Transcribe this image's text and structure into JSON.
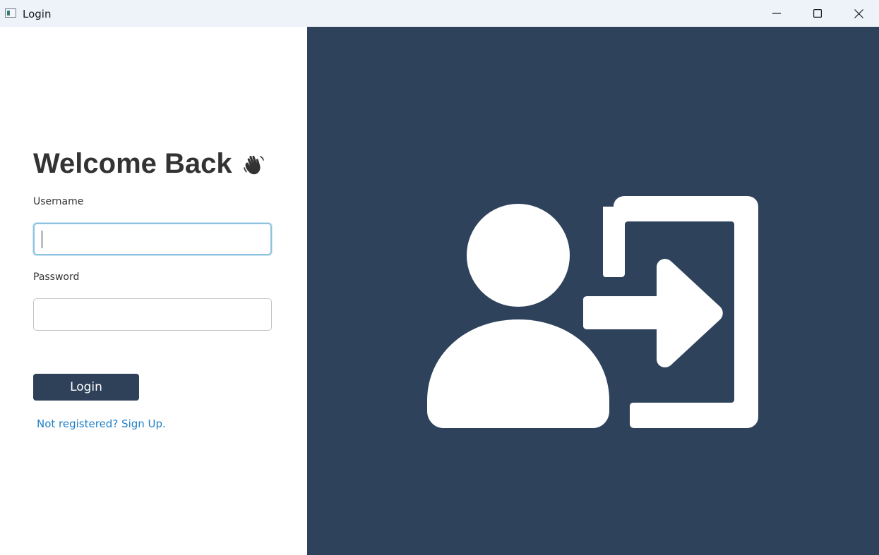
{
  "window": {
    "title": "Login",
    "icons": {
      "app": "app-window-icon",
      "minimize": "minimize-icon",
      "maximize": "maximize-icon",
      "close": "close-icon"
    }
  },
  "form": {
    "heading": "Welcome Back",
    "heading_icon": "waving-hand-icon",
    "username_label": "Username",
    "username_value": "",
    "password_label": "Password",
    "password_value": "",
    "login_label": "Login",
    "signup_link": "Not registered? Sign Up."
  },
  "illustration": {
    "icon": "user-login-icon"
  },
  "colors": {
    "panel_background": "#2f425c",
    "button_background": "#2f4159",
    "link": "#1f7fc8",
    "focus_border": "#8dc3df",
    "heading_text": "#333333"
  }
}
